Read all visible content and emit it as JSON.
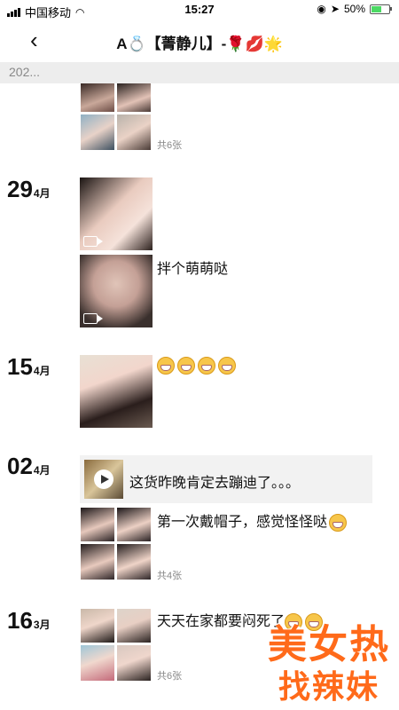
{
  "status_bar": {
    "carrier": "中国移动",
    "time": "15:27",
    "battery": "50%",
    "battery_level": 0.5
  },
  "navbar": {
    "back_icon": "chevron-left-icon",
    "title": "A💍【菁静儿】-🌹💋🌟"
  },
  "year_label": "202...",
  "posts": [
    {
      "count": "共6张"
    },
    {
      "day": "29",
      "month": "4月",
      "text": "拌个萌萌哒"
    },
    {
      "day": "15",
      "month": "4月",
      "emoji_count": 4
    },
    {
      "day": "02",
      "month": "4月",
      "share_text": "这货昨晚肯定去蹦迪了。。。",
      "text": "第一次戴帽子，感觉怪怪哒",
      "count": "共4张"
    },
    {
      "day": "16",
      "month": "3月",
      "text": "天天在家都要闷死了",
      "count": "共6张"
    }
  ],
  "watermark": {
    "line1": "美女热",
    "line2": "找辣妹"
  },
  "colors": {
    "watermark": "#ff6a1a",
    "yearbar": "#ededed"
  }
}
